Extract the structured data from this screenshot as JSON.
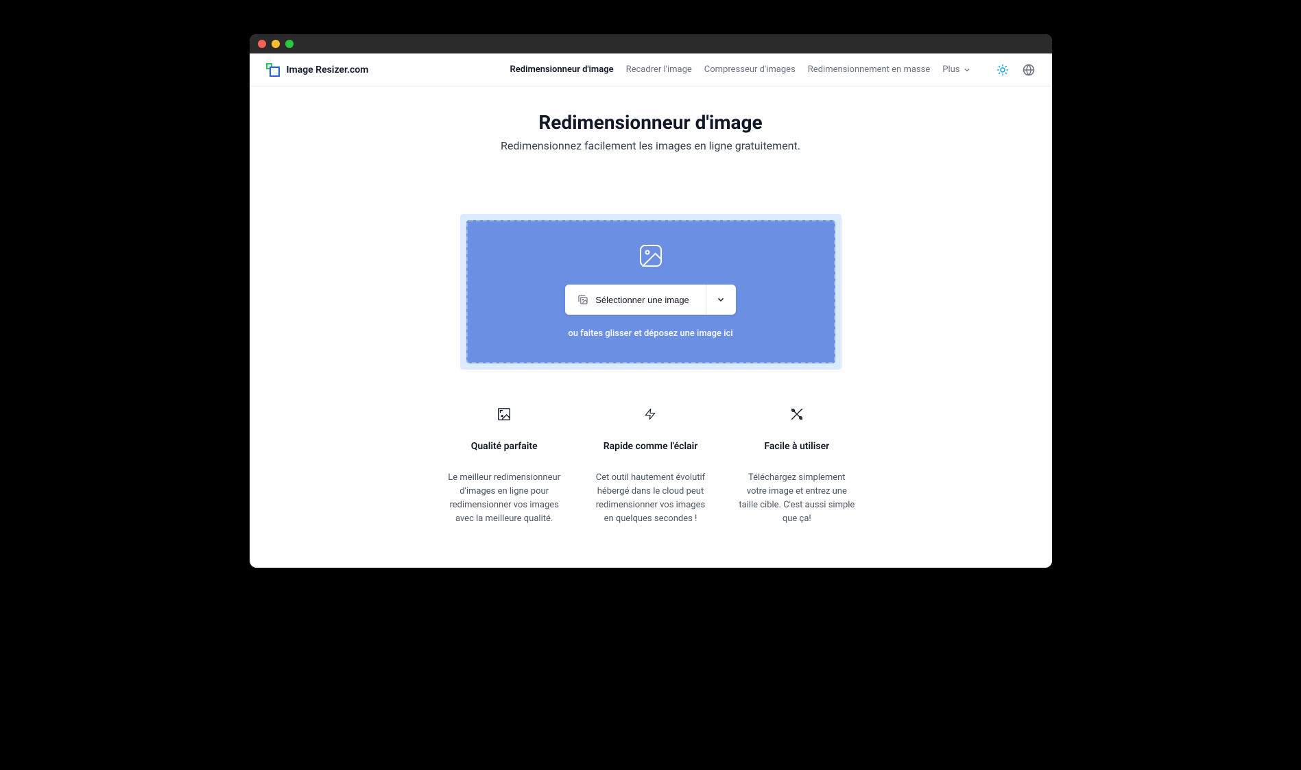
{
  "brand": {
    "name": "Image Resizer.com"
  },
  "nav": {
    "items": [
      {
        "label": "Redimensionneur d'image",
        "active": true
      },
      {
        "label": "Recadrer l'image",
        "active": false
      },
      {
        "label": "Compresseur d'images",
        "active": false
      },
      {
        "label": "Redimensionnement en masse",
        "active": false
      }
    ],
    "more_label": "Plus"
  },
  "hero": {
    "title": "Redimensionneur d'image",
    "subtitle": "Redimensionnez facilement les images en ligne gratuitement."
  },
  "dropzone": {
    "select_label": "Sélectionner une image",
    "drag_text": "ou faites glisser et déposez une image ici"
  },
  "features": [
    {
      "title": "Qualité parfaite",
      "desc": "Le meilleur redimensionneur d'images en ligne pour redimensionner vos images avec la meilleure qualité."
    },
    {
      "title": "Rapide comme l'éclair",
      "desc": "Cet outil hautement évolutif hébergé dans le cloud peut redimensionner vos images en quelques secondes !"
    },
    {
      "title": "Facile à utiliser",
      "desc": "Téléchargez simplement votre image et entrez une taille cible. C'est aussi simple que ça!"
    }
  ]
}
